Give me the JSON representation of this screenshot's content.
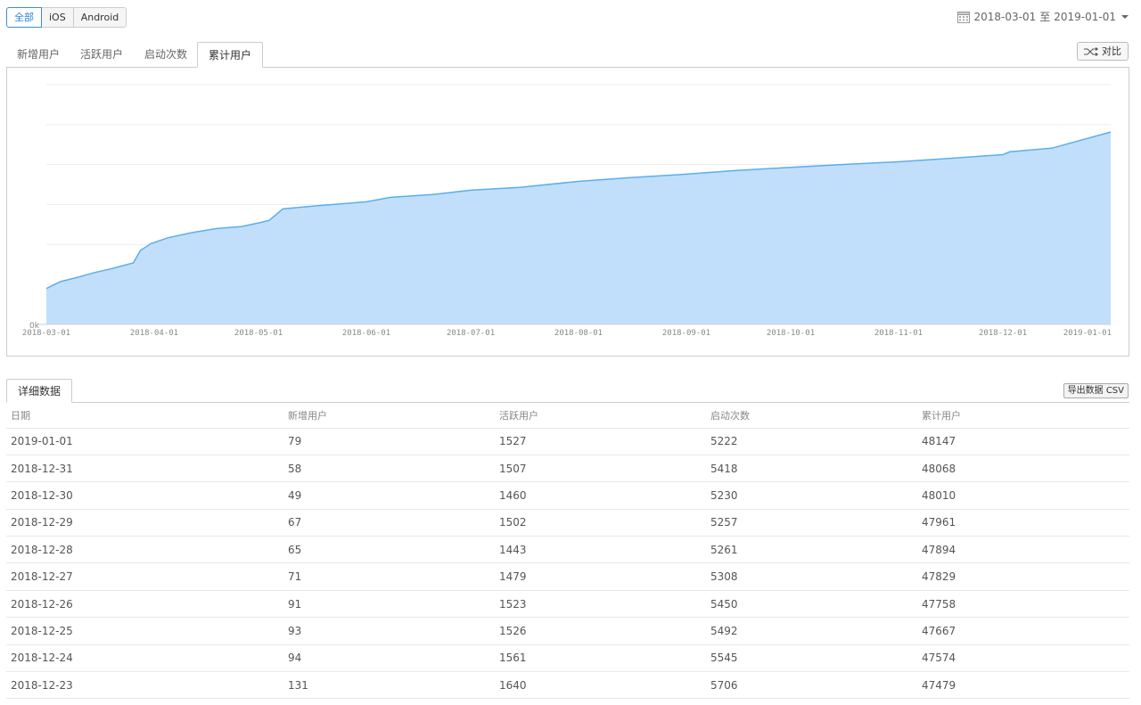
{
  "platform": {
    "options": [
      "全部",
      "iOS",
      "Android"
    ],
    "selected": "全部"
  },
  "date_range": {
    "start": "2018-03-01",
    "to_label": "至",
    "end": "2019-01-01"
  },
  "metric_tabs": [
    "新增用户",
    "活跃用户",
    "启动次数",
    "累计用户"
  ],
  "active_metric": "累计用户",
  "compare_label": "对比",
  "chart_data": {
    "type": "area",
    "title": "",
    "xlabel": "",
    "ylabel": "",
    "y_tick_labels": [
      "0k"
    ],
    "x_tick_labels": [
      "2018-03-01",
      "2018-04-01",
      "2018-05-01",
      "2018-06-01",
      "2018-07-01",
      "2018-08-01",
      "2018-09-01",
      "2018-10-01",
      "2018-11-01",
      "2018-12-01",
      "2019-01-01"
    ],
    "ylim": [
      0,
      60000
    ],
    "grid": true,
    "fill_color": "#c1dffa",
    "line_color": "#5caeee",
    "series": [
      {
        "x": [
          "2018-03-01",
          "2018-03-05",
          "2018-03-10",
          "2018-03-15",
          "2018-03-20",
          "2018-03-26",
          "2018-03-28",
          "2018-03-31",
          "2018-04-05",
          "2018-04-12",
          "2018-04-19",
          "2018-04-26",
          "2018-05-01",
          "2018-05-04",
          "2018-05-08",
          "2018-05-18",
          "2018-06-01",
          "2018-06-08",
          "2018-06-20",
          "2018-07-01",
          "2018-07-15",
          "2018-08-01",
          "2018-08-15",
          "2018-09-01",
          "2018-09-15",
          "2018-10-01",
          "2018-10-15",
          "2018-11-01",
          "2018-11-15",
          "2018-12-01",
          "2018-12-03",
          "2018-12-15",
          "2019-01-01"
        ],
        "values": [
          9000,
          10700,
          11800,
          13000,
          14000,
          15400,
          18500,
          20200,
          21700,
          23000,
          24000,
          24500,
          25400,
          26000,
          28900,
          29700,
          30700,
          31800,
          32500,
          33600,
          34300,
          35800,
          36700,
          37600,
          38500,
          39300,
          40000,
          40700,
          41500,
          42500,
          43200,
          44100,
          48147
        ]
      }
    ]
  },
  "details": {
    "tab_label": "详细数据",
    "export_label": "导出数据 CSV",
    "columns": [
      "日期",
      "新增用户",
      "活跃用户",
      "启动次数",
      "累计用户"
    ],
    "rows": [
      [
        "2019-01-01",
        "79",
        "1527",
        "5222",
        "48147"
      ],
      [
        "2018-12-31",
        "58",
        "1507",
        "5418",
        "48068"
      ],
      [
        "2018-12-30",
        "49",
        "1460",
        "5230",
        "48010"
      ],
      [
        "2018-12-29",
        "67",
        "1502",
        "5257",
        "47961"
      ],
      [
        "2018-12-28",
        "65",
        "1443",
        "5261",
        "47894"
      ],
      [
        "2018-12-27",
        "71",
        "1479",
        "5308",
        "47829"
      ],
      [
        "2018-12-26",
        "91",
        "1523",
        "5450",
        "47758"
      ],
      [
        "2018-12-25",
        "93",
        "1526",
        "5492",
        "47667"
      ],
      [
        "2018-12-24",
        "94",
        "1561",
        "5545",
        "47574"
      ],
      [
        "2018-12-23",
        "131",
        "1640",
        "5706",
        "47479"
      ]
    ]
  }
}
